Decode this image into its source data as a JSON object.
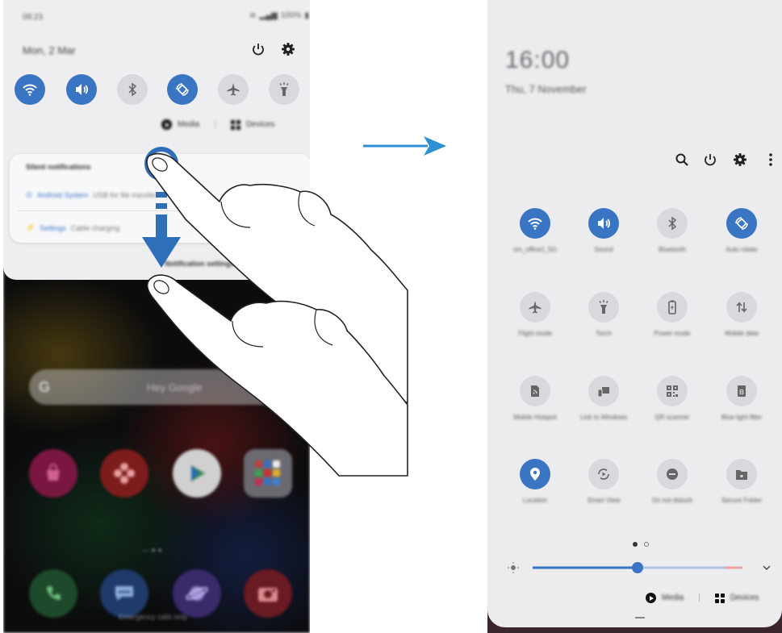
{
  "left_panel": {
    "status_time": "09:23",
    "status_battery": "100%",
    "date": "Mon, 2 Mar",
    "media_label": "Media",
    "devices_label": "Devices",
    "notifications": {
      "section_title": "Silent notifications",
      "item1_app": "Android System",
      "item1_text": "USB for file transfer",
      "item2_app": "Settings",
      "item2_text": "Cable charging",
      "footer": "Notification settings"
    },
    "search_text": "Hey Google",
    "dock_caption": "Emergency calls only"
  },
  "right_panel": {
    "time": "16:00",
    "date": "Thu, 7 November",
    "tiles": [
      {
        "icon": "wifi-icon",
        "label": "sm_office1_5G",
        "on": true
      },
      {
        "icon": "sound-icon",
        "label": "Sound",
        "on": true
      },
      {
        "icon": "bluetooth-icon",
        "label": "Bluetooth",
        "on": false
      },
      {
        "icon": "auto-rotate-icon",
        "label": "Auto rotate",
        "on": true
      },
      {
        "icon": "airplane-icon",
        "label": "Flight mode",
        "on": false
      },
      {
        "icon": "torch-icon",
        "label": "Torch",
        "on": false
      },
      {
        "icon": "battery-icon",
        "label": "Power mode",
        "on": false
      },
      {
        "icon": "mobile-data-icon",
        "label": "Mobile data",
        "on": false
      },
      {
        "icon": "hotspot-icon",
        "label": "Mobile Hotspot",
        "on": false
      },
      {
        "icon": "link-to-windows-icon",
        "label": "Link to Windows",
        "on": false
      },
      {
        "icon": "qr-icon",
        "label": "QR scanner",
        "on": false
      },
      {
        "icon": "blue-light-icon",
        "label": "Blue light filter",
        "on": false
      },
      {
        "icon": "location-icon",
        "label": "Location",
        "on": true
      },
      {
        "icon": "smart-view-icon",
        "label": "Smart View",
        "on": false
      },
      {
        "icon": "do-not-disturb-icon",
        "label": "Do not disturb",
        "on": false
      },
      {
        "icon": "secure-folder-icon",
        "label": "Secure Folder",
        "on": false
      }
    ],
    "media_label": "Media",
    "devices_label": "Devices",
    "brightness_level": 0.5
  },
  "colors": {
    "accent": "#3a75c4",
    "tile_off": "#d9d9dd",
    "panel": "#ececee"
  }
}
